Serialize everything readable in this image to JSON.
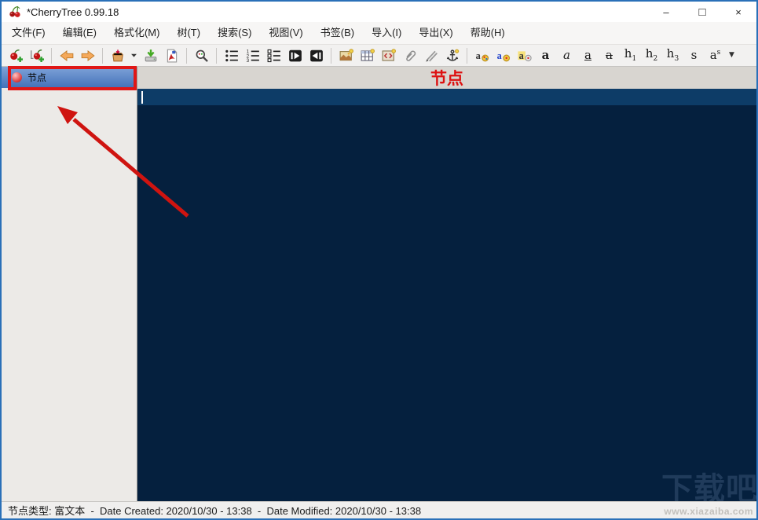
{
  "window": {
    "title": "*CherryTree 0.99.18",
    "controls": {
      "minimize": "–",
      "maximize": "□",
      "close": "×"
    }
  },
  "menubar": {
    "items": [
      {
        "id": "file",
        "label": "文件(F)"
      },
      {
        "id": "edit",
        "label": "编辑(E)"
      },
      {
        "id": "format",
        "label": "格式化(M)"
      },
      {
        "id": "tree",
        "label": "树(T)"
      },
      {
        "id": "search",
        "label": "搜索(S)"
      },
      {
        "id": "view",
        "label": "视图(V)"
      },
      {
        "id": "bookmarks",
        "label": "书签(B)"
      },
      {
        "id": "import",
        "label": "导入(I)"
      },
      {
        "id": "export",
        "label": "导出(X)"
      },
      {
        "id": "help",
        "label": "帮助(H)"
      }
    ]
  },
  "toolbar": {
    "items": [
      {
        "id": "add-node",
        "icon": "cherryAdd"
      },
      {
        "id": "add-subnode",
        "icon": "cherrySubAdd"
      },
      {
        "sep": true
      },
      {
        "id": "go-back",
        "icon": "arrowLeft"
      },
      {
        "id": "go-forward",
        "icon": "arrowRight"
      },
      {
        "sep": true
      },
      {
        "id": "open-file",
        "icon": "openBox"
      },
      {
        "id": "recent-docs-dropdown",
        "icon": "caretDown"
      },
      {
        "id": "save",
        "icon": "saveDrive"
      },
      {
        "id": "export-pdf",
        "icon": "pdfPage"
      },
      {
        "sep": true
      },
      {
        "id": "find-in-nodes",
        "icon": "magnifier"
      },
      {
        "sep": true
      },
      {
        "id": "bulleted-list",
        "icon": "bulletList"
      },
      {
        "id": "numbered-list",
        "icon": "numberedList"
      },
      {
        "id": "todo-list",
        "icon": "todoList"
      },
      {
        "id": "indent-increase",
        "icon": "indentRight"
      },
      {
        "id": "indent-decrease",
        "icon": "indentLeft"
      },
      {
        "sep": true
      },
      {
        "id": "insert-image",
        "icon": "imagePic"
      },
      {
        "id": "insert-table",
        "icon": "tableGrid"
      },
      {
        "id": "insert-codebox",
        "icon": "codeBox"
      },
      {
        "id": "insert-attachment",
        "icon": "paperclip"
      },
      {
        "id": "insert-link",
        "icon": "linkPens"
      },
      {
        "id": "insert-anchor",
        "icon": "anchor"
      },
      {
        "sep": true
      },
      {
        "id": "color-foreground",
        "icon": "colorFg"
      },
      {
        "id": "color-background",
        "icon": "colorBg"
      },
      {
        "id": "remove-formatting",
        "icon": "removeFormat"
      },
      {
        "id": "bold",
        "text": "a",
        "style": "b"
      },
      {
        "id": "italic",
        "text": "a",
        "style": "i"
      },
      {
        "id": "underline",
        "text": "a",
        "style": "u"
      },
      {
        "id": "strikethrough",
        "text": "a",
        "style": "st"
      },
      {
        "id": "heading-1",
        "text": "h",
        "sub": "1"
      },
      {
        "id": "heading-2",
        "text": "h",
        "sub": "2"
      },
      {
        "id": "heading-3",
        "text": "h",
        "sub": "3"
      },
      {
        "id": "small-text",
        "text": "s"
      },
      {
        "id": "superscript",
        "text": "a",
        "sup": "s"
      },
      {
        "id": "formatting-dropdown",
        "text": "▼",
        "style": "caret"
      }
    ]
  },
  "tree": {
    "selected_node_label": "节点"
  },
  "editor": {
    "node_title": "节点"
  },
  "statusbar": {
    "text": "节点类型: 富文本  -  Date Created: 2020/10/30 - 13:38  -  Date Modified: 2020/10/30 - 13:38"
  },
  "watermark": {
    "big": "下载吧",
    "small": "www.xiazaiba.com"
  },
  "colors": {
    "selection_blue": "#4371b8",
    "annotation_red": "#e01616",
    "editor_bg": "#05203e",
    "current_line_bg": "#0d3c67",
    "node_title_red": "#dd1111"
  }
}
